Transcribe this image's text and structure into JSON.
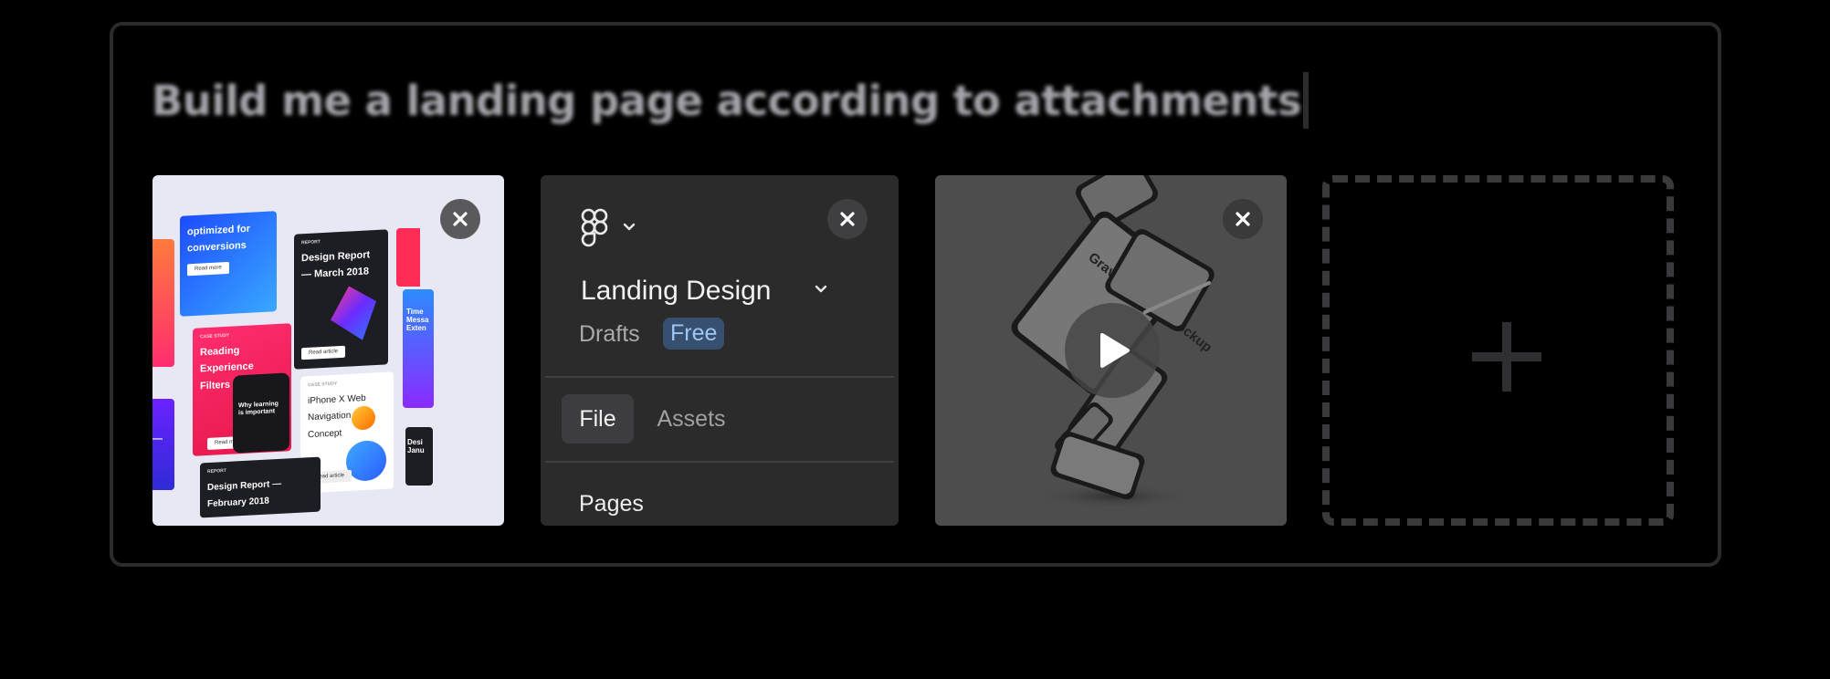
{
  "prompt": {
    "text": "Build me a landing page according to attachments"
  },
  "attachments": {
    "image_card": {
      "collage": {
        "card_a_title": "optimized for conversions",
        "card_a_btn": "Read more",
        "card_b_label": "REPORT",
        "card_b_title": "Design Report — March 2018",
        "card_b_btn": "Read article",
        "card_c_label": "CASE STUDY",
        "card_c_title": "Reading Experience Filters Concept",
        "card_c_btn": "Read more",
        "card_d_title": "Why learning is important",
        "card_e_label": "CASE STUDY",
        "card_e_title": "iPhone X Web Navigation Concept",
        "card_e_btn": "Read article",
        "card_f_label": "REPORT",
        "card_f_title": "Design Report — February 2018",
        "card_g_title": "Time Messa Exten",
        "card_h_title": "Desi Janu",
        "card_i_title": "rt—"
      }
    },
    "figma_card": {
      "file_title": "Landing Design",
      "location": "Drafts",
      "plan_badge": "Free",
      "tabs": [
        {
          "label": "File",
          "active": true
        },
        {
          "label": "Assets",
          "active": false
        }
      ],
      "section_label": "Pages"
    },
    "video_card": {
      "overlay_text": "Gravity Design Mockup"
    },
    "add_card": {
      "icon": "plus-icon"
    }
  },
  "colors": {
    "background": "#000000",
    "panel_border": "#2b2b2d",
    "figma_panel": "#2b2b2c",
    "badge_bg": "#37506f",
    "badge_text": "#9ec6f2",
    "dashed_border": "#3a3a3c"
  }
}
